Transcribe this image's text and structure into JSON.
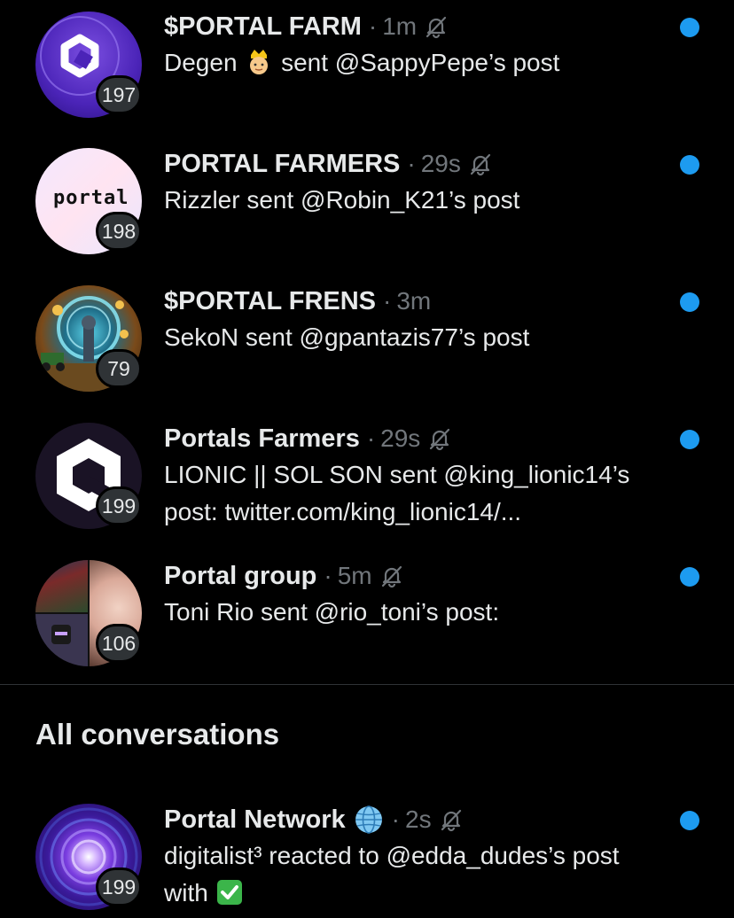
{
  "pinned": [
    {
      "name": "$PORTAL FARM",
      "separator": "·",
      "time": "1m",
      "muted": true,
      "badge": "197",
      "preview_pre": "Degen",
      "preview_emoji": "crown-person-emoji",
      "preview_post": "sent @SappyPepe’s post",
      "unread": true
    },
    {
      "name": "PORTAL FARMERS",
      "separator": "·",
      "time": "29s",
      "muted": true,
      "badge": "198",
      "avatar_text": "portal",
      "preview": "Rizzler sent @Robin_K21’s post",
      "unread": true
    },
    {
      "name": "$PORTAL FRENS",
      "separator": "·",
      "time": "3m",
      "muted": false,
      "badge": "79",
      "preview": "SekoN sent @gpantazis77’s post",
      "unread": true
    },
    {
      "name": "Portals Farmers",
      "separator": "·",
      "time": "29s",
      "muted": true,
      "badge": "199",
      "preview_line1": "LIONIC || SOL SON sent @king_lionic14’s",
      "preview_line2": "post: twitter.com/king_lionic14/...",
      "unread": true
    },
    {
      "name": "Portal group",
      "separator": "·",
      "time": "5m",
      "muted": true,
      "badge": "106",
      "preview": "Toni Rio sent @rio_toni’s post:",
      "unread": true
    }
  ],
  "section_title": "All conversations",
  "all": [
    {
      "name": "Portal Network",
      "name_emoji": "globe-icon",
      "separator": "·",
      "time": "2s",
      "muted": true,
      "badge": "199",
      "preview_line1": "digitalist³ reacted to @edda_dudes’s post",
      "preview_line2": "with",
      "preview_emoji": "check-mark-button-emoji",
      "unread": true
    }
  ],
  "colors": {
    "background": "#000000",
    "primary_text": "#e7e9ea",
    "secondary_text": "#71767b",
    "unread_dot": "#1d9bf0",
    "badge_bg": "#2f3336",
    "divider": "#2f3336"
  }
}
